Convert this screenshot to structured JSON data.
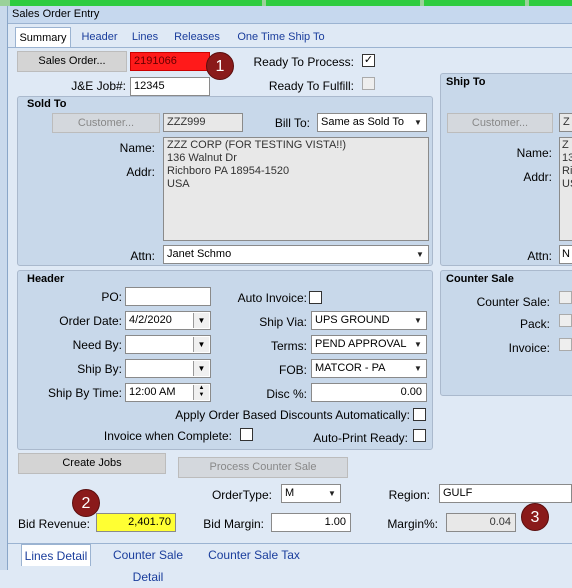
{
  "window": {
    "title": "Sales Order Entry"
  },
  "tabs": [
    {
      "label": "Summary"
    },
    {
      "label": "Header"
    },
    {
      "label": "Lines"
    },
    {
      "label": "Releases"
    },
    {
      "label": "One Time Ship To"
    }
  ],
  "top": {
    "sales_order_btn": "Sales Order...",
    "sales_order_value": "2191066",
    "job_label": "J&E Job#:",
    "job_value": "12345",
    "ready_process_label": "Ready To Process:",
    "ready_process_checked": true,
    "ready_fulfill_label": "Ready To Fulfill:"
  },
  "sold_to": {
    "title": "Sold To",
    "customer_btn": "Customer...",
    "customer_value": "ZZZ999",
    "bill_to_label": "Bill To:",
    "bill_to_value": "Same as Sold To",
    "name_label": "Name:",
    "addr_label": "Addr:",
    "address_lines": [
      "ZZZ CORP (FOR TESTING VISTA!!)",
      "136 Walnut Dr",
      "Richboro PA 18954-1520",
      "USA"
    ],
    "attn_label": "Attn:",
    "attn_value": "Janet Schmo"
  },
  "ship_to": {
    "title": "Ship To",
    "customer_btn": "Customer...",
    "customer_value": "Z",
    "name_label": "Name:",
    "addr_label": "Addr:",
    "address_lines": [
      "Z",
      "13",
      "Ri",
      "US"
    ],
    "attn_label": "Attn:",
    "attn_value": "N"
  },
  "header": {
    "title": "Header",
    "po_label": "PO:",
    "po_value": "",
    "order_date_label": "Order Date:",
    "order_date_value": "4/2/2020",
    "need_by_label": "Need By:",
    "need_by_value": "",
    "ship_by_label": "Ship By:",
    "ship_by_value": "",
    "ship_by_time_label": "Ship By Time:",
    "ship_by_time_value": "12:00 AM",
    "auto_invoice_label": "Auto Invoice:",
    "ship_via_label": "Ship Via:",
    "ship_via_value": "UPS  GROUND",
    "terms_label": "Terms:",
    "terms_value": "PEND APPROVAL",
    "fob_label": "FOB:",
    "fob_value": "MATCOR - PA",
    "disc_label": "Disc %:",
    "disc_value": "0.00",
    "apply_discount_label": "Apply Order Based Discounts Automatically:",
    "invoice_complete_label": "Invoice when Complete:",
    "auto_print_label": "Auto-Print Ready:"
  },
  "counter_sale": {
    "title": "Counter Sale",
    "counter_sale_label": "Counter Sale:",
    "pack_label": "Pack:",
    "invoice_label": "Invoice:"
  },
  "bottom": {
    "create_jobs_btn": "Create Jobs",
    "process_counter_btn": "Process Counter Sale",
    "order_type_label": "OrderType:",
    "order_type_value": "M",
    "region_label": "Region:",
    "region_value": "GULF",
    "bid_revenue_label": "Bid Revenue:",
    "bid_revenue_value": "2,401.70",
    "bid_margin_label": "Bid Margin:",
    "bid_margin_value": "1.00",
    "margin_pct_label": "Margin%:",
    "margin_pct_value": "0.04"
  },
  "badges": [
    "1",
    "2",
    "3"
  ],
  "bottom_tabs": [
    {
      "label": "Lines Detail"
    },
    {
      "label": "Counter Sale Detail"
    },
    {
      "label": "Counter Sale Tax"
    }
  ],
  "colors": {
    "sales_order_highlight": "#ff1a1a",
    "bid_revenue_highlight": "#ffff33",
    "badge": "#8a1a1a"
  }
}
